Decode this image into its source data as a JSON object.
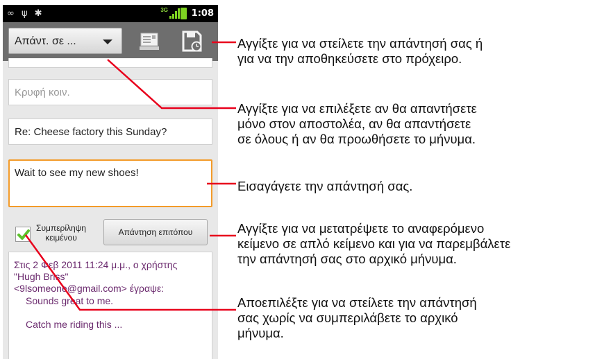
{
  "status_bar": {
    "time": "1:08",
    "left_icons": [
      "voicemail-icon",
      "usb-icon",
      "android-icon"
    ],
    "network": "3G"
  },
  "toolbar": {
    "reply_mode": "Απάντ. σε ...",
    "send_icon": "send-icon",
    "save_draft_icon": "save-draft-icon"
  },
  "form": {
    "bcc_placeholder": "Κρυφή κοιν.",
    "subject": "Re: Cheese factory this Sunday?",
    "body": "Wait to see my new shoes!",
    "include_quoted_label": "Συμπερίληψη κειμένου",
    "include_quoted_checked": true,
    "respond_inline_label": "Απάντηση επιτόπου"
  },
  "quoted": {
    "header_lines": [
      "Στις 2 Φεβ 2011 11:24 μ.μ., ο χρήστης",
      "\"Hugh Briss\"",
      "<9lsomeone@gmail.com> έγραψε:"
    ],
    "body_lines": [
      "Sounds great to me.",
      "",
      "Catch me riding this ..."
    ]
  },
  "annotations": {
    "send": [
      "Αγγίξτε για να στείλετε την απάντησή σας ή",
      "για να την αποθηκεύσετε στο πρόχειρο."
    ],
    "reply_mode": [
      "Αγγίξτε για να επιλέξετε αν θα απαντήσετε",
      "μόνο στον αποστολέα, αν θα απαντήσετε",
      "σε όλους ή αν θα προωθήσετε το μήνυμα."
    ],
    "body": [
      "Εισαγάγετε την απάντησή σας."
    ],
    "inline": [
      "Αγγίξτε για να μετατρέψετε το αναφερόμενο",
      "κείμενο σε απλό κείμενο και για να παρεμβάλετε",
      "την απάντησή σας στο αρχικό μήνυμα."
    ],
    "uncheck": [
      "Αποεπιλέξτε για να στείλετε την απάντησή",
      "σας χωρίς να συμπεριλάβετε το αρχικό",
      "μήνυμα."
    ]
  },
  "colors": {
    "leader_line": "#e8001c",
    "focus_border": "#f39b29",
    "quoted_text": "#6b2a6e",
    "checkmark": "#5cc22b"
  }
}
